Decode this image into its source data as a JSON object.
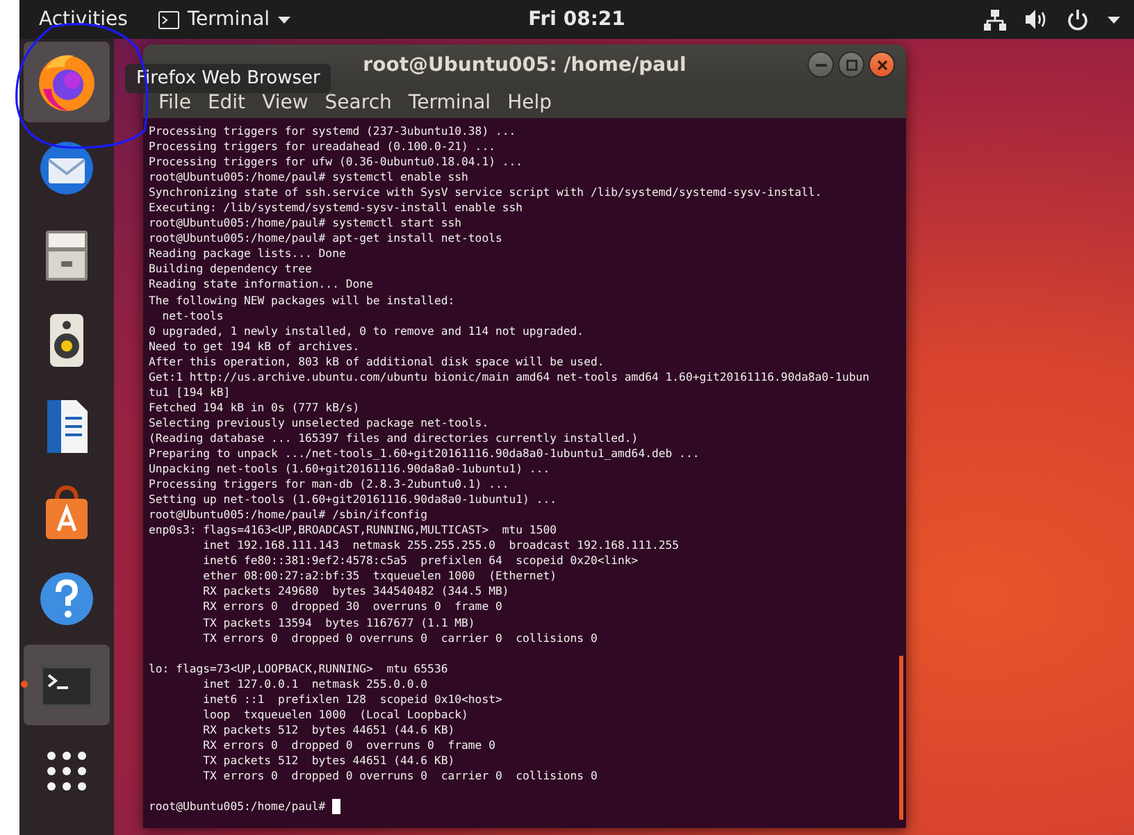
{
  "top_bar": {
    "activities": "Activities",
    "app_menu": "Terminal",
    "clock": "Fri 08:21"
  },
  "dock": [
    {
      "kind": "browser",
      "highlighted": true,
      "running": false
    },
    {
      "kind": "mail",
      "highlighted": false,
      "running": false
    },
    {
      "kind": "files",
      "highlighted": false,
      "running": false
    },
    {
      "kind": "music",
      "highlighted": false,
      "running": false
    },
    {
      "kind": "document",
      "highlighted": false,
      "running": false
    },
    {
      "kind": "store",
      "highlighted": false,
      "running": false
    },
    {
      "kind": "help",
      "highlighted": false,
      "running": false
    },
    {
      "kind": "terminal",
      "highlighted": true,
      "running": true
    },
    {
      "kind": "apps",
      "highlighted": false,
      "running": false
    }
  ],
  "tooltip": "Firefox Web Browser",
  "window": {
    "title": "root@Ubuntu005: /home/paul",
    "menu": [
      "File",
      "Edit",
      "View",
      "Search",
      "Terminal",
      "Help"
    ],
    "cursor_visible": true,
    "lines": [
      {
        "text": "Processing triggers for systemd (237-3ubuntu10.38) ..."
      },
      {
        "text": "Processing triggers for ureadahead (0.100.0-21) ..."
      },
      {
        "text": "Processing triggers for ufw (0.36-0ubuntu0.18.04.1) ..."
      },
      {
        "text": "root@Ubuntu005:/home/paul# systemctl enable ssh"
      },
      {
        "text": "Synchronizing state of ssh.service with SysV service script with /lib/systemd/systemd-sysv-install."
      },
      {
        "text": "Executing: /lib/systemd/systemd-sysv-install enable ssh"
      },
      {
        "text": "root@Ubuntu005:/home/paul# systemctl start ssh"
      },
      {
        "text": "root@Ubuntu005:/home/paul# apt-get install net-tools"
      },
      {
        "text": "Reading package lists... Done"
      },
      {
        "text": "Building dependency tree"
      },
      {
        "text": "Reading state information... Done"
      },
      {
        "text": "The following NEW packages will be installed:"
      },
      {
        "text": "  net-tools"
      },
      {
        "text": "0 upgraded, 1 newly installed, 0 to remove and 114 not upgraded."
      },
      {
        "text": "Need to get 194 kB of archives."
      },
      {
        "text": "After this operation, 803 kB of additional disk space will be used."
      },
      {
        "text": "Get:1 http://us.archive.ubuntu.com/ubuntu bionic/main amd64 net-tools amd64 1.60+git20161116.90da8a0-1ubun"
      },
      {
        "text": "tu1 [194 kB]"
      },
      {
        "text": "Fetched 194 kB in 0s (777 kB/s)"
      },
      {
        "text": "Selecting previously unselected package net-tools."
      },
      {
        "text": "(Reading database ... 165397 files and directories currently installed.)"
      },
      {
        "text": "Preparing to unpack .../net-tools_1.60+git20161116.90da8a0-1ubuntu1_amd64.deb ..."
      },
      {
        "text": "Unpacking net-tools (1.60+git20161116.90da8a0-1ubuntu1) ..."
      },
      {
        "text": "Processing triggers for man-db (2.8.3-2ubuntu0.1) ..."
      },
      {
        "text": "Setting up net-tools (1.60+git20161116.90da8a0-1ubuntu1) ..."
      },
      {
        "text": "root@Ubuntu005:/home/paul# /sbin/ifconfig"
      },
      {
        "text": "enp0s3: flags=4163<UP,BROADCAST,RUNNING,MULTICAST>  mtu 1500"
      },
      {
        "text": "        inet 192.168.111.143  netmask 255.255.255.0  broadcast 192.168.111.255"
      },
      {
        "text": "        inet6 fe80::381:9ef2:4578:c5a5  prefixlen 64  scopeid 0x20<link>"
      },
      {
        "text": "        ether 08:00:27:a2:bf:35  txqueuelen 1000  (Ethernet)"
      },
      {
        "text": "        RX packets 249680  bytes 344540482 (344.5 MB)"
      },
      {
        "text": "        RX errors 0  dropped 30  overruns 0  frame 0"
      },
      {
        "text": "        TX packets 13594  bytes 1167677 (1.1 MB)"
      },
      {
        "text": "        TX errors 0  dropped 0 overruns 0  carrier 0  collisions 0"
      },
      {
        "text": "lo: flags=73<UP,LOOPBACK,RUNNING>  mtu 65536",
        "space_before": true
      },
      {
        "text": "        inet 127.0.0.1  netmask 255.0.0.0"
      },
      {
        "text": "        inet6 ::1  prefixlen 128  scopeid 0x10<host>"
      },
      {
        "text": "        loop  txqueuelen 1000  (Local Loopback)"
      },
      {
        "text": "        RX packets 512  bytes 44651 (44.6 KB)"
      },
      {
        "text": "        RX errors 0  dropped 0  overruns 0  frame 0"
      },
      {
        "text": "        TX packets 512  bytes 44651 (44.6 KB)"
      },
      {
        "text": "        TX errors 0  dropped 0 overruns 0  carrier 0  collisions 0"
      },
      {
        "text": "root@Ubuntu005:/home/paul# ",
        "space_before": true
      }
    ]
  }
}
